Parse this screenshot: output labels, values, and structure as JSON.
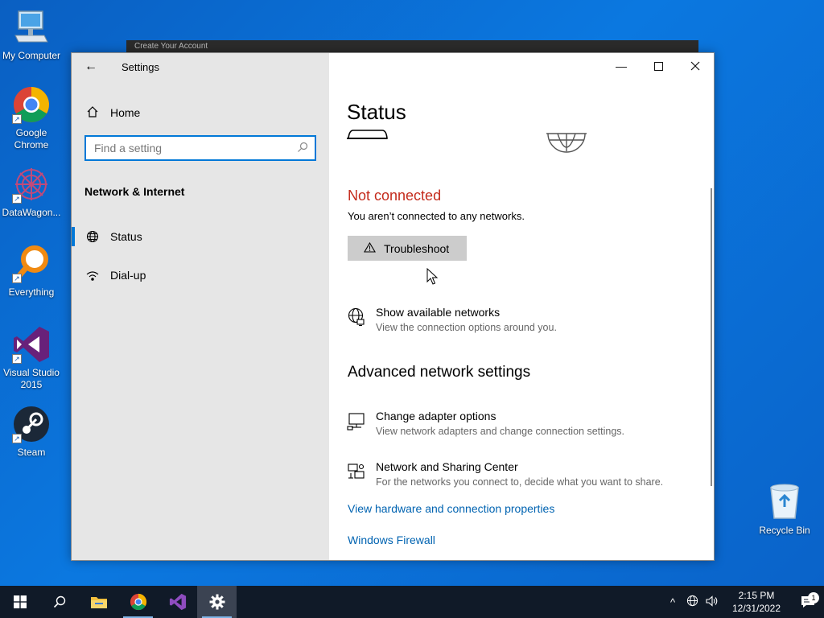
{
  "desktop": {
    "icons": [
      {
        "label": "My Computer"
      },
      {
        "label": "Google Chrome"
      },
      {
        "label": "DataWagon..."
      },
      {
        "label": "Everything"
      },
      {
        "label": "Visual Studio 2015"
      },
      {
        "label": "Steam"
      }
    ],
    "recycle_bin": "Recycle Bin",
    "background_window_title": "Create Your Account"
  },
  "window": {
    "title": "Settings",
    "sidebar": {
      "home": "Home",
      "search_placeholder": "Find a setting",
      "section": "Network & Internet",
      "items": [
        {
          "label": "Status",
          "active": true
        },
        {
          "label": "Dial-up",
          "active": false
        }
      ]
    },
    "content": {
      "title": "Status",
      "status_heading": "Not connected",
      "status_description": "You aren’t connected to any networks.",
      "troubleshoot_label": "Troubleshoot",
      "show_networks": {
        "title": "Show available networks",
        "desc": "View the connection options around you."
      },
      "advanced_title": "Advanced network settings",
      "adapter_options": {
        "title": "Change adapter options",
        "desc": "View network adapters and change connection settings."
      },
      "sharing_center": {
        "title": "Network and Sharing Center",
        "desc": "For the networks you connect to, decide what you want to share."
      },
      "link_hardware": "View hardware and connection properties",
      "link_firewall": "Windows Firewall"
    }
  },
  "taskbar": {
    "time": "2:15 PM",
    "date": "12/31/2022",
    "notification_count": "1"
  },
  "colors": {
    "accent": "#0078d7",
    "error": "#c42b1c",
    "link": "#0063b1"
  }
}
